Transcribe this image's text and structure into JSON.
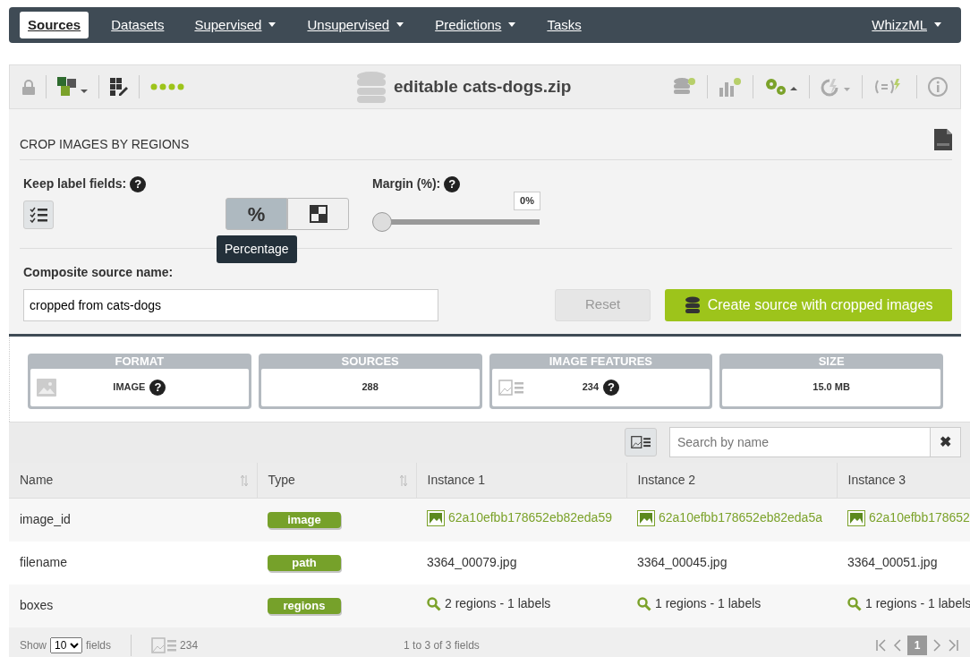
{
  "navbar": {
    "items": [
      {
        "label": "Sources",
        "selected": true,
        "dropdown": false
      },
      {
        "label": "Datasets",
        "selected": false,
        "dropdown": false
      },
      {
        "label": "Supervised",
        "selected": false,
        "dropdown": true
      },
      {
        "label": "Unsupervised",
        "selected": false,
        "dropdown": true
      },
      {
        "label": "Predictions",
        "selected": false,
        "dropdown": true
      },
      {
        "label": "Tasks",
        "selected": false,
        "dropdown": false
      }
    ],
    "right": {
      "label": "WhizzML",
      "dropdown": true
    }
  },
  "toolbar": {
    "title": "editable cats-dogs.zip"
  },
  "crop_panel": {
    "title": "CROP IMAGES BY REGIONS",
    "keep_label_fields": {
      "label": "Keep label fields:",
      "help": "?"
    },
    "margin": {
      "label": "Margin (%):",
      "help": "?",
      "reading": "0%",
      "level": 0
    },
    "modes": [
      {
        "kind": "percentage",
        "label": "%",
        "selected": true
      },
      {
        "kind": "pixels",
        "selected": false
      }
    ],
    "tooltip": "Percentage",
    "composite_label": "Composite source name:",
    "composite_value": "cropped from cats-dogs",
    "reset": {
      "label": "Reset",
      "disabled": true
    },
    "create": {
      "label": "Create source with cropped images"
    }
  },
  "summary": [
    {
      "kind": "image",
      "heading": "FORMAT",
      "value": "IMAGE",
      "help": "?"
    },
    {
      "kind": "plain",
      "heading": "SOURCES",
      "value": "288"
    },
    {
      "kind": "features",
      "heading": "IMAGE FEATURES",
      "value": "234",
      "help": "?"
    },
    {
      "kind": "plain",
      "heading": "SIZE",
      "value": "15.0 MB"
    }
  ],
  "search": {
    "placeholder": "Search by name",
    "clear": "✖"
  },
  "table": {
    "columns": [
      {
        "label": "Name",
        "sortable": true
      },
      {
        "label": "Type",
        "sortable": true
      },
      {
        "label": "Instance 1",
        "sortable": false
      },
      {
        "label": "Instance 2",
        "sortable": false
      },
      {
        "label": "Instance 3",
        "sortable": false
      }
    ],
    "rows": [
      {
        "cells": [
          {
            "kind": "text",
            "text": "image_id"
          },
          {
            "kind": "type",
            "text": "image"
          },
          {
            "kind": "image",
            "text": "62a10efbb178652eb82eda59"
          },
          {
            "kind": "image",
            "text": "62a10efbb178652eb82eda5a"
          },
          {
            "kind": "image",
            "text": "62a10efbb178652"
          }
        ]
      },
      {
        "cells": [
          {
            "kind": "text",
            "text": "filename"
          },
          {
            "kind": "type",
            "text": "path"
          },
          {
            "kind": "text",
            "text": "3364_00079.jpg"
          },
          {
            "kind": "text",
            "text": "3364_00045.jpg"
          },
          {
            "kind": "text",
            "text": "3364_00051.jpg"
          }
        ]
      },
      {
        "cells": [
          {
            "kind": "text",
            "text": "boxes"
          },
          {
            "kind": "type",
            "text": "regions"
          },
          {
            "kind": "regions",
            "text": "2 regions - 1 labels"
          },
          {
            "kind": "regions",
            "text": "1 regions - 1 labels"
          },
          {
            "kind": "regions",
            "text": "1 regions - 1 labels"
          }
        ]
      }
    ]
  },
  "footer": {
    "show": "Show",
    "page_size": "10",
    "fields": "fields",
    "feature_count": "234",
    "range": "1 to 3 of 3 fields",
    "page": "1"
  }
}
